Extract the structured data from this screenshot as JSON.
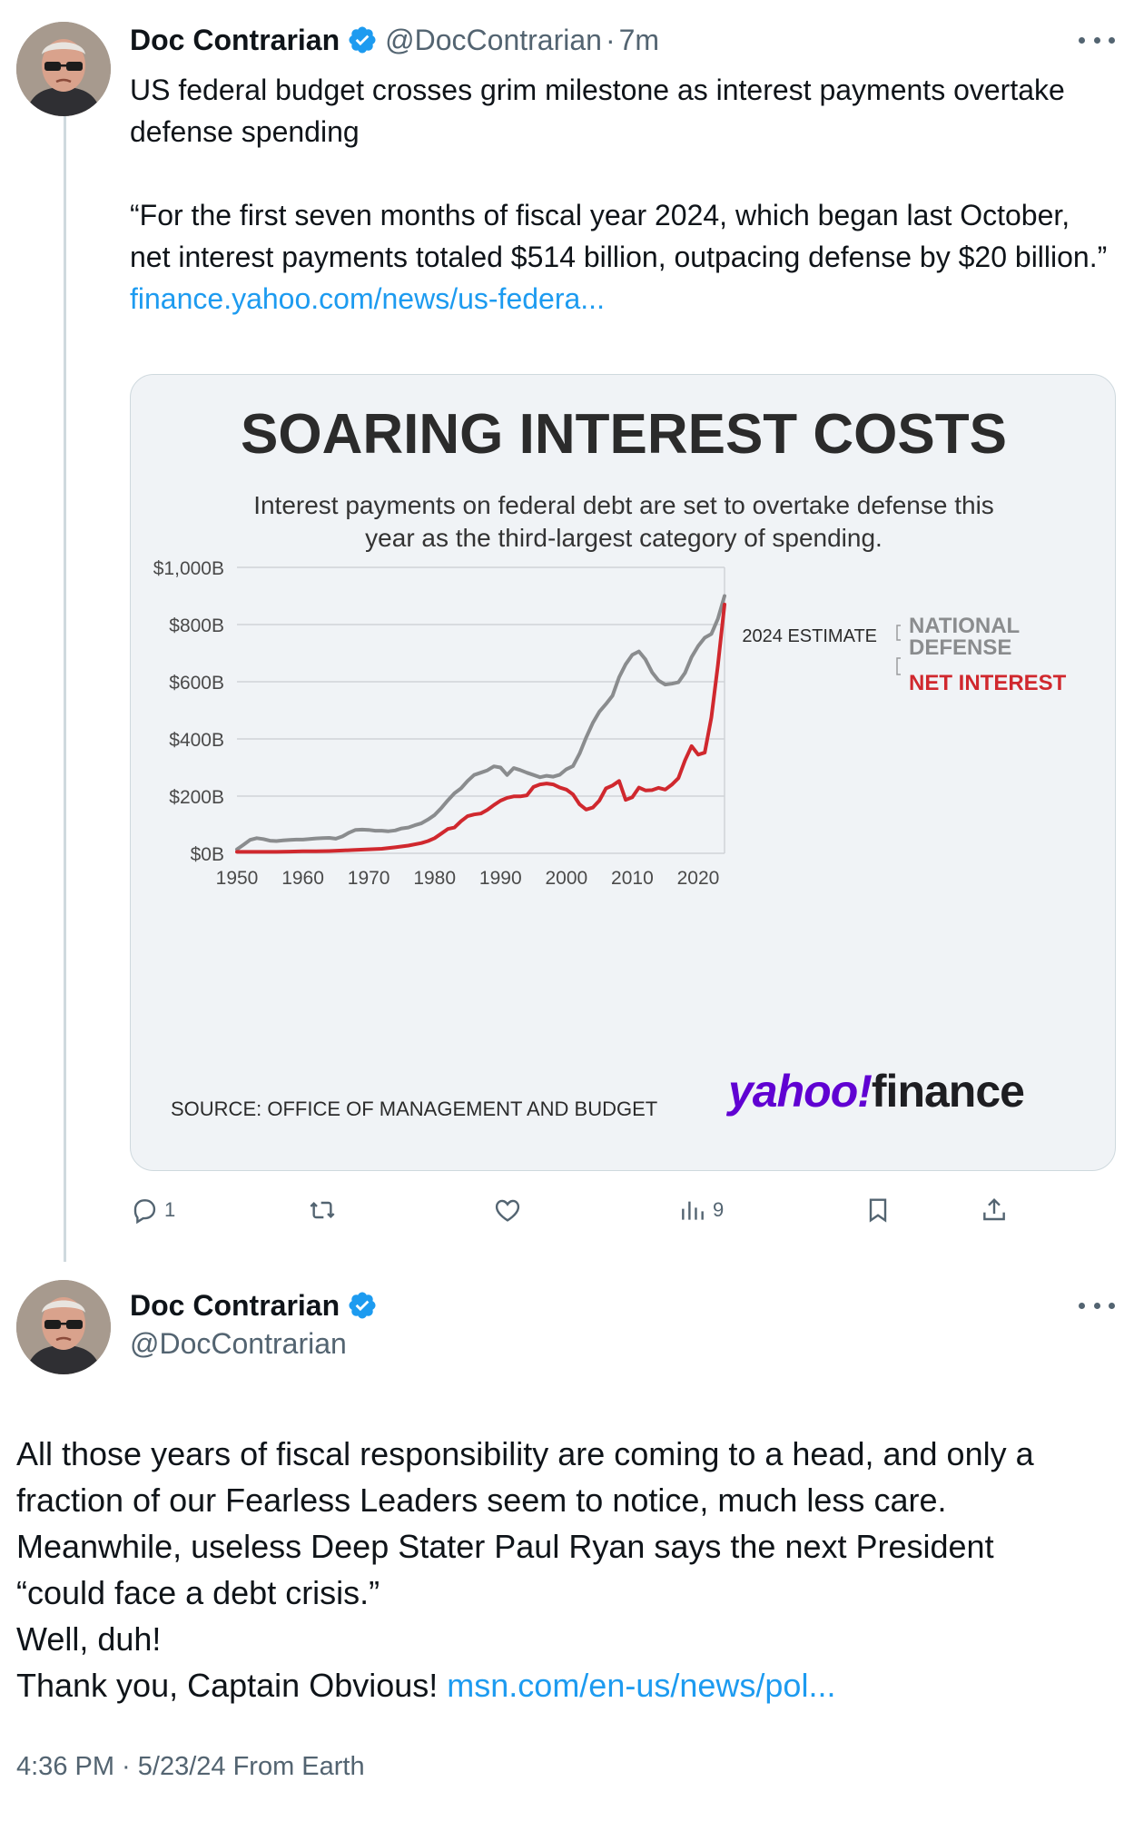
{
  "tweet1": {
    "author_name": "Doc Contrarian",
    "handle": "@DocContrarian",
    "separator": "·",
    "time": "7m",
    "text_line1": "US federal budget crosses grim milestone as interest payments overtake defense spending",
    "quote": "“For the first seven months of fiscal year 2024, which began last October, net interest payments totaled $514 billion, outpacing defense by $20 billion.”",
    "link": "finance.yahoo.com/news/us-federa...",
    "actions": {
      "reply_count": "1",
      "retweet_count": "",
      "like_count": "",
      "views_count": "9"
    }
  },
  "card": {
    "title": "SOARING INTEREST COSTS",
    "subtitle_line1": "Interest payments on federal debt are set to overtake defense this",
    "subtitle_line2": "year as the third-largest category of spending.",
    "estimate_label": "2024 ESTIMATE",
    "legend_defense_line1": "NATIONAL",
    "legend_defense_line2": "DEFENSE",
    "legend_interest": "NET INTEREST",
    "source": "SOURCE: OFFICE OF MANAGEMENT AND BUDGET",
    "brand_word1": "yahoo",
    "brand_mark": "!",
    "brand_word2": "finance",
    "colors": {
      "defense": "#8a8c8e",
      "interest": "#d0282e",
      "brand": "#6001d2",
      "background": "#f0f3f6"
    }
  },
  "chart_data": {
    "type": "line",
    "title": "SOARING INTEREST COSTS",
    "subtitle": "Interest payments on federal debt are set to overtake defense this year as the third-largest category of spending.",
    "xlim": [
      1950,
      2024
    ],
    "ylim": [
      0,
      1000
    ],
    "x_ticks": [
      "1950",
      "1960",
      "1970",
      "1980",
      "1990",
      "2000",
      "2010",
      "2020"
    ],
    "y_ticks": [
      "$0B",
      "$200B",
      "$400B",
      "$600B",
      "$800B",
      "$1,000B"
    ],
    "y_tick_values": [
      0,
      200,
      400,
      600,
      800,
      1000
    ],
    "grid": true,
    "legend_placement": "right, at line ends",
    "series": [
      {
        "name": "NATIONAL DEFENSE",
        "color": "#8a8c8e",
        "points": [
          [
            1950,
            14
          ],
          [
            1951,
            30
          ],
          [
            1952,
            47
          ],
          [
            1953,
            53
          ],
          [
            1954,
            50
          ],
          [
            1955,
            44
          ],
          [
            1956,
            43
          ],
          [
            1957,
            45
          ],
          [
            1958,
            47
          ],
          [
            1959,
            48
          ],
          [
            1960,
            48
          ],
          [
            1961,
            50
          ],
          [
            1962,
            52
          ],
          [
            1963,
            53
          ],
          [
            1964,
            54
          ],
          [
            1965,
            51
          ],
          [
            1966,
            59
          ],
          [
            1967,
            72
          ],
          [
            1968,
            82
          ],
          [
            1969,
            83
          ],
          [
            1970,
            82
          ],
          [
            1971,
            79
          ],
          [
            1972,
            79
          ],
          [
            1973,
            77
          ],
          [
            1974,
            80
          ],
          [
            1975,
            87
          ],
          [
            1976,
            90
          ],
          [
            1977,
            98
          ],
          [
            1978,
            105
          ],
          [
            1979,
            118
          ],
          [
            1980,
            134
          ],
          [
            1981,
            158
          ],
          [
            1982,
            185
          ],
          [
            1983,
            210
          ],
          [
            1984,
            227
          ],
          [
            1985,
            253
          ],
          [
            1986,
            274
          ],
          [
            1987,
            282
          ],
          [
            1988,
            290
          ],
          [
            1989,
            304
          ],
          [
            1990,
            300
          ],
          [
            1991,
            274
          ],
          [
            1992,
            298
          ],
          [
            1993,
            291
          ],
          [
            1994,
            282
          ],
          [
            1995,
            274
          ],
          [
            1996,
            266
          ],
          [
            1997,
            271
          ],
          [
            1998,
            268
          ],
          [
            1999,
            275
          ],
          [
            2000,
            294
          ],
          [
            2001,
            305
          ],
          [
            2002,
            349
          ],
          [
            2003,
            405
          ],
          [
            2004,
            456
          ],
          [
            2005,
            495
          ],
          [
            2006,
            522
          ],
          [
            2007,
            551
          ],
          [
            2008,
            616
          ],
          [
            2009,
            661
          ],
          [
            2010,
            694
          ],
          [
            2011,
            706
          ],
          [
            2012,
            678
          ],
          [
            2013,
            633
          ],
          [
            2014,
            604
          ],
          [
            2015,
            590
          ],
          [
            2016,
            593
          ],
          [
            2017,
            598
          ],
          [
            2018,
            631
          ],
          [
            2019,
            686
          ],
          [
            2020,
            725
          ],
          [
            2021,
            754
          ],
          [
            2022,
            767
          ],
          [
            2023,
            820
          ],
          [
            2024,
            900
          ]
        ]
      },
      {
        "name": "NET INTEREST",
        "color": "#d0282e",
        "points": [
          [
            1950,
            5
          ],
          [
            1952,
            5
          ],
          [
            1954,
            5
          ],
          [
            1956,
            5
          ],
          [
            1958,
            6
          ],
          [
            1960,
            7
          ],
          [
            1962,
            7
          ],
          [
            1964,
            8
          ],
          [
            1966,
            10
          ],
          [
            1968,
            12
          ],
          [
            1970,
            14
          ],
          [
            1972,
            16
          ],
          [
            1974,
            21
          ],
          [
            1976,
            27
          ],
          [
            1978,
            36
          ],
          [
            1979,
            43
          ],
          [
            1980,
            53
          ],
          [
            1981,
            69
          ],
          [
            1982,
            85
          ],
          [
            1983,
            90
          ],
          [
            1984,
            112
          ],
          [
            1985,
            130
          ],
          [
            1986,
            136
          ],
          [
            1987,
            139
          ],
          [
            1988,
            152
          ],
          [
            1989,
            169
          ],
          [
            1990,
            184
          ],
          [
            1991,
            194
          ],
          [
            1992,
            199
          ],
          [
            1993,
            199
          ],
          [
            1994,
            203
          ],
          [
            1995,
            232
          ],
          [
            1996,
            241
          ],
          [
            1997,
            244
          ],
          [
            1998,
            241
          ],
          [
            1999,
            230
          ],
          [
            2000,
            223
          ],
          [
            2001,
            206
          ],
          [
            2002,
            171
          ],
          [
            2003,
            153
          ],
          [
            2004,
            160
          ],
          [
            2005,
            184
          ],
          [
            2006,
            227
          ],
          [
            2007,
            237
          ],
          [
            2008,
            253
          ],
          [
            2009,
            187
          ],
          [
            2010,
            196
          ],
          [
            2011,
            230
          ],
          [
            2012,
            220
          ],
          [
            2013,
            221
          ],
          [
            2014,
            229
          ],
          [
            2015,
            223
          ],
          [
            2016,
            240
          ],
          [
            2017,
            263
          ],
          [
            2018,
            325
          ],
          [
            2019,
            375
          ],
          [
            2020,
            345
          ],
          [
            2021,
            352
          ],
          [
            2022,
            475
          ],
          [
            2023,
            658
          ],
          [
            2024,
            870
          ]
        ]
      }
    ]
  },
  "tweet2": {
    "author_name": "Doc Contrarian",
    "handle": "@DocContrarian",
    "line1": "All those years of fiscal responsibility are coming to a head, and only a",
    "line2": "fraction of our Fearless Leaders seem to notice, much less care.",
    "line3": "Meanwhile, useless Deep Stater Paul Ryan says the next President",
    "line4": "“could face a debt crisis.”",
    "line5": "Well, duh!",
    "line6_text": "Thank you, Captain Obvious!",
    "line6_link": "msn.com/en-us/news/pol...",
    "meta": "4:36 PM · 5/23/24 From Earth"
  }
}
